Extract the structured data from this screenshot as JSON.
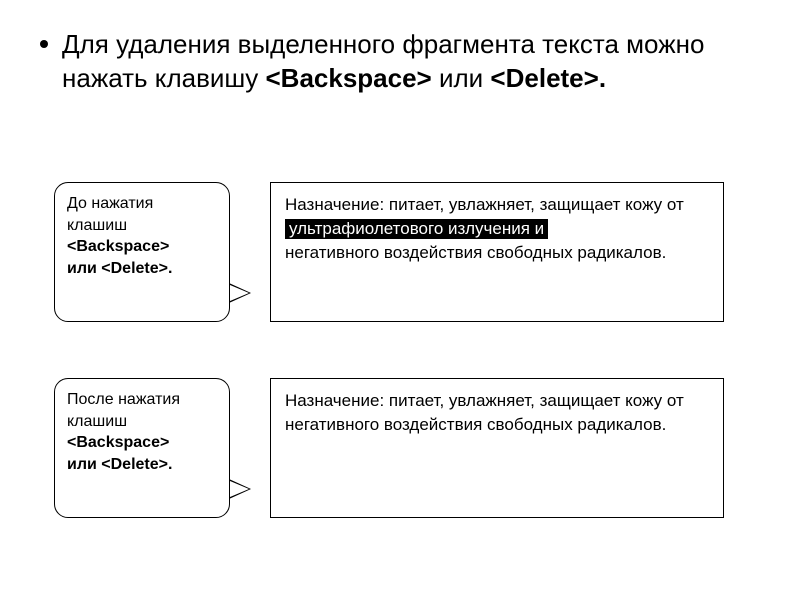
{
  "bullet": {
    "prefix": "Для удаления выделенного фрагмента текста можно нажать клавишу ",
    "key1": "<Backspace>",
    "mid": " или ",
    "key2": "<Delete>",
    "suffix": "."
  },
  "before": {
    "label_l1": "До нажатия клашиш",
    "label_k1": "<Backspace>",
    "label_mid": " или ",
    "label_k2": "<Delete>",
    "label_end": ".",
    "text_before_hl": "Назначение: питает, увлажняет, защищает кожу от  ",
    "hl": "ультрафиолетового излучения и",
    "text_after_hl": "  негативного воздействия свободных радикалов."
  },
  "after": {
    "label_l1": "После нажатия клашиш",
    "label_k1": "<Backspace>",
    "label_mid": " или ",
    "label_k2": "<Delete>",
    "label_end": ".",
    "text": "Назначение: питает, увлажняет, защищает кожу от негативного воздействия свободных радикалов."
  }
}
